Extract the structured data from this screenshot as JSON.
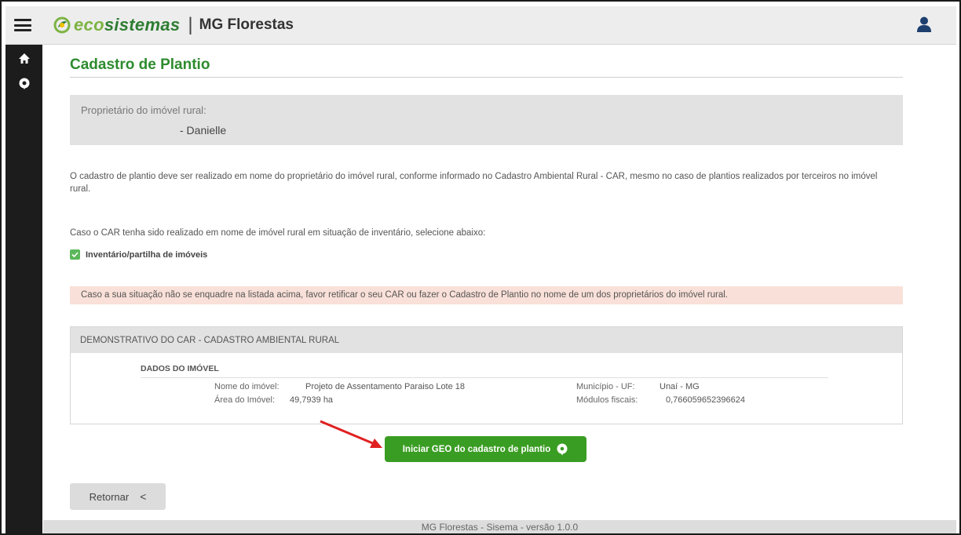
{
  "header": {
    "brand_eco": "eco",
    "brand_sistemas": "sistemas",
    "separator": "|",
    "app_name": "MG Florestas"
  },
  "sidebar": {
    "items": [
      {
        "icon": "home-icon"
      },
      {
        "icon": "map-marker-icon"
      }
    ]
  },
  "page": {
    "title": "Cadastro de Plantio",
    "owner_label": "Proprietário do imóvel rural:",
    "owner_name": "- Danielle",
    "info_text": "O cadastro de plantio deve ser realizado em nome do proprietário do imóvel rural, conforme informado no Cadastro Ambiental Rural - CAR, mesmo no caso de plantios realizados por terceiros no imóvel rural.",
    "ask_text": "Caso o CAR tenha sido realizado em nome de imóvel rural em situação de inventário, selecione abaixo:",
    "checkbox_label": "Inventário/partilha de imóveis",
    "checkbox_checked": true,
    "alert_text": "Caso a sua situação não se enquadre na listada acima, favor retificar o seu CAR ou fazer o Cadastro de Plantio no nome de um dos proprietários do imóvel rural."
  },
  "car": {
    "header": "DEMONSTRATIVO DO CAR - CADASTRO AMBIENTAL RURAL",
    "section_title": "DADOS DO IMÓVEL",
    "nome_label": "Nome do imóvel:",
    "nome_value": "Projeto de Assentamento Paraiso Lote 18",
    "area_label": "Área do Imóvel:",
    "area_value": "49,7939 ha",
    "municipio_label": "Município - UF:",
    "municipio_value": "Unaí - MG",
    "modulos_label": "Módulos fiscais:",
    "modulos_value": "0,766059652396624"
  },
  "actions": {
    "start_geo": "Iniciar GEO do cadastro de plantio",
    "back": "Retornar",
    "back_chevron": "<"
  },
  "footer": {
    "text": "MG Florestas - Sisema - versão 1.0.0"
  },
  "colors": {
    "primary_green": "#3a9d23",
    "title_green": "#2e8b2e",
    "alert_bg": "#f9e0d8",
    "sidebar_bg": "#1c1c1c",
    "annotation_arrow": "#e02020"
  }
}
